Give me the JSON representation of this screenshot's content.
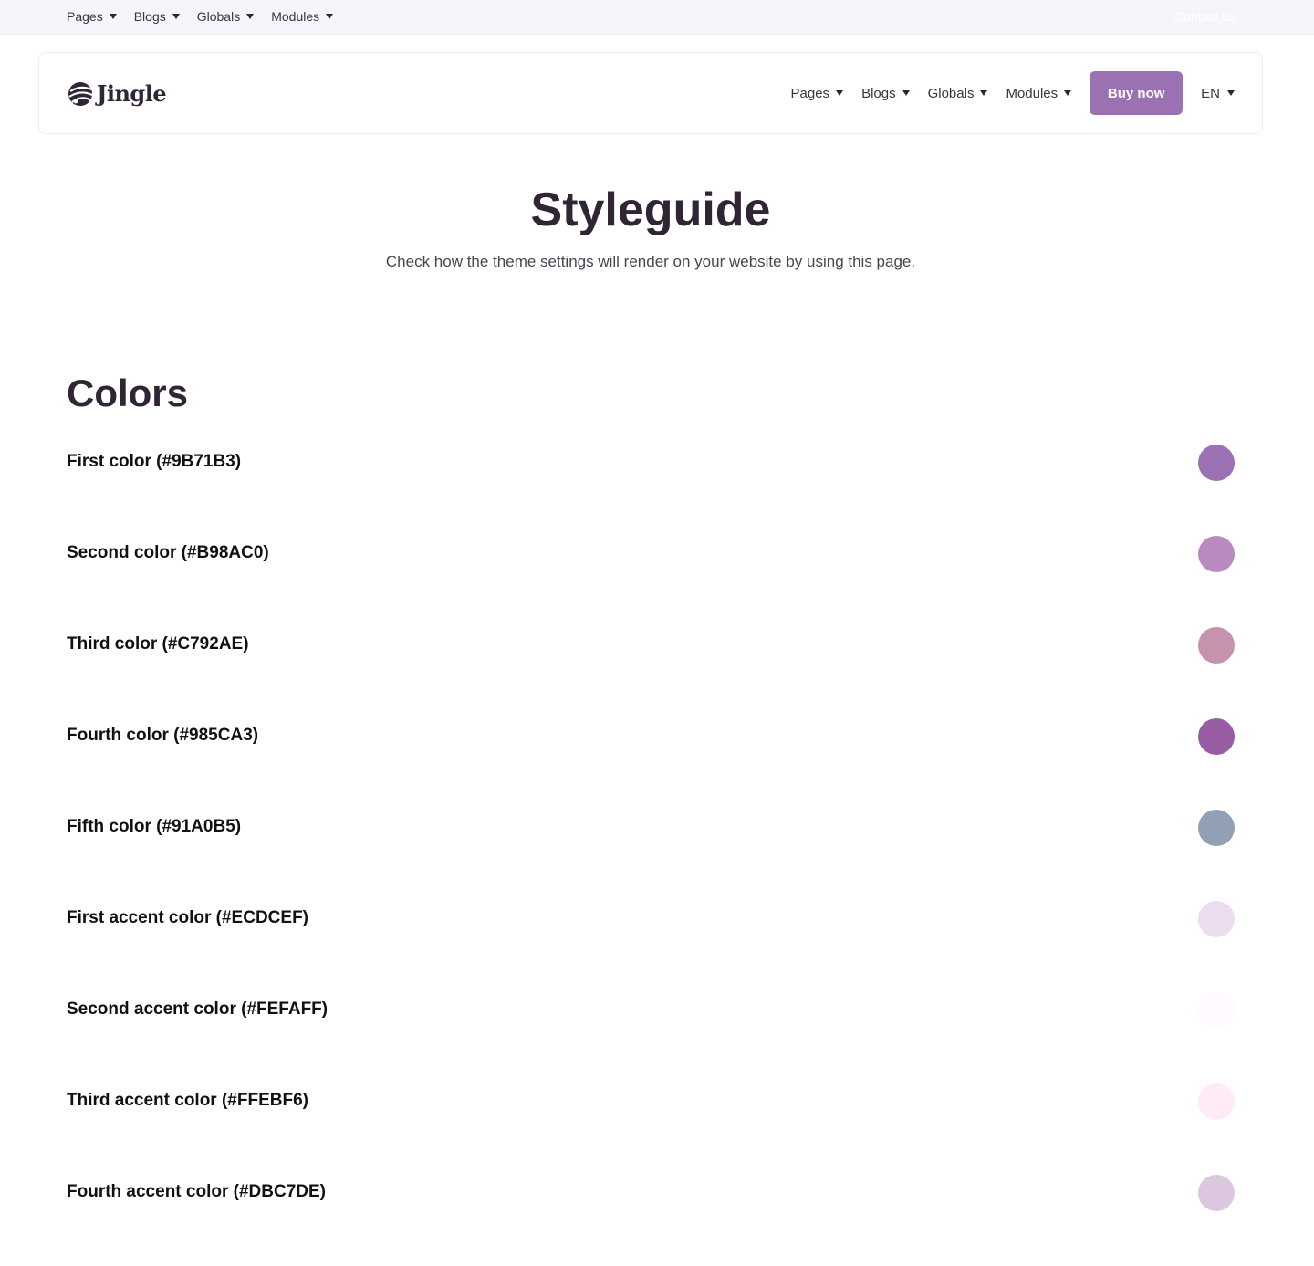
{
  "topbar": {
    "nav": [
      {
        "label": "Pages"
      },
      {
        "label": "Blogs"
      },
      {
        "label": "Globals"
      },
      {
        "label": "Modules"
      }
    ],
    "contact_label": "Contact us"
  },
  "header": {
    "logo_text": "Jingle",
    "nav": [
      {
        "label": "Pages"
      },
      {
        "label": "Blogs"
      },
      {
        "label": "Globals"
      },
      {
        "label": "Modules"
      }
    ],
    "buy_label": "Buy now",
    "language": "EN",
    "accent_color": "#9b71b3"
  },
  "hero": {
    "title": "Styleguide",
    "subtitle": "Check how the theme settings will render on your website by using this page."
  },
  "colors_section": {
    "title": "Colors",
    "items": [
      {
        "label": "First color (#9B71B3)",
        "hex": "#9B71B3"
      },
      {
        "label": "Second color (#B98AC0)",
        "hex": "#B98AC0"
      },
      {
        "label": "Third color (#C792AE)",
        "hex": "#C792AE"
      },
      {
        "label": "Fourth color (#985CA3)",
        "hex": "#985CA3"
      },
      {
        "label": "Fifth color (#91A0B5)",
        "hex": "#91A0B5"
      },
      {
        "label": "First accent color (#ECDCEF)",
        "hex": "#ECDCEF"
      },
      {
        "label": "Second accent color (#FEFAFF)",
        "hex": "#FEFAFF"
      },
      {
        "label": "Third accent color (#FFEBF6)",
        "hex": "#FFEBF6"
      },
      {
        "label": "Fourth accent color (#DBC7DE)",
        "hex": "#DBC7DE"
      }
    ]
  }
}
